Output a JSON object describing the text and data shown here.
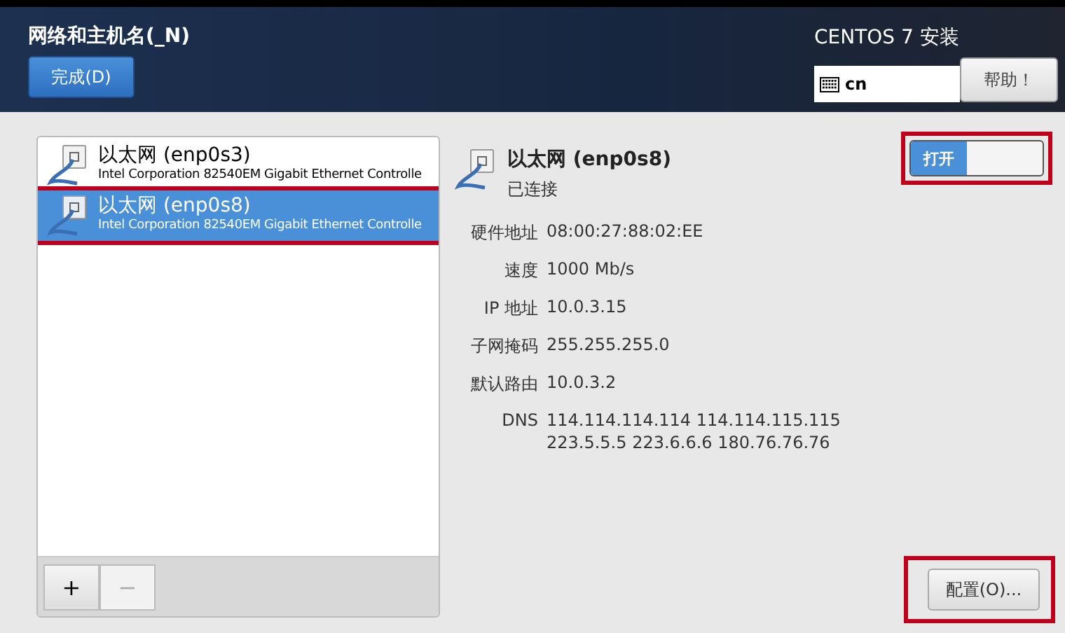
{
  "header": {
    "title": "网络和主机名(_N)",
    "done_button": "完成(D)",
    "product": "CENTOS 7 安装",
    "keyboard_layout": "cn",
    "help_button": "帮助！"
  },
  "devices": [
    {
      "name": "以太网 (enp0s3)",
      "description": "Intel Corporation 82540EM Gigabit Ethernet Controlle",
      "selected": false,
      "highlighted": false
    },
    {
      "name": "以太网 (enp0s8)",
      "description": "Intel Corporation 82540EM Gigabit Ethernet Controlle",
      "selected": true,
      "highlighted": true
    }
  ],
  "list_buttons": [
    {
      "label": "+",
      "disabled": false
    },
    {
      "label": "−",
      "disabled": true
    }
  ],
  "detail": {
    "name": "以太网 (enp0s8)",
    "status": "已连接",
    "switch": {
      "label": "打开",
      "on": true,
      "highlighted": true
    },
    "fields": [
      {
        "label": "硬件地址",
        "values": [
          "08:00:27:88:02:EE"
        ]
      },
      {
        "label": "速度",
        "values": [
          "1000 Mb/s"
        ]
      },
      {
        "label": "IP 地址",
        "values": [
          "10.0.3.15"
        ]
      },
      {
        "label": "子网掩码",
        "values": [
          "255.255.255.0"
        ]
      },
      {
        "label": "默认路由",
        "values": [
          "10.0.3.2"
        ]
      },
      {
        "label": "DNS",
        "values": [
          "114.114.114.114 114.114.115.115",
          "223.5.5.5 223.6.6.6 180.76.76.76"
        ]
      }
    ],
    "configure_button": {
      "label": "配置(O)...",
      "highlighted": true
    }
  }
}
